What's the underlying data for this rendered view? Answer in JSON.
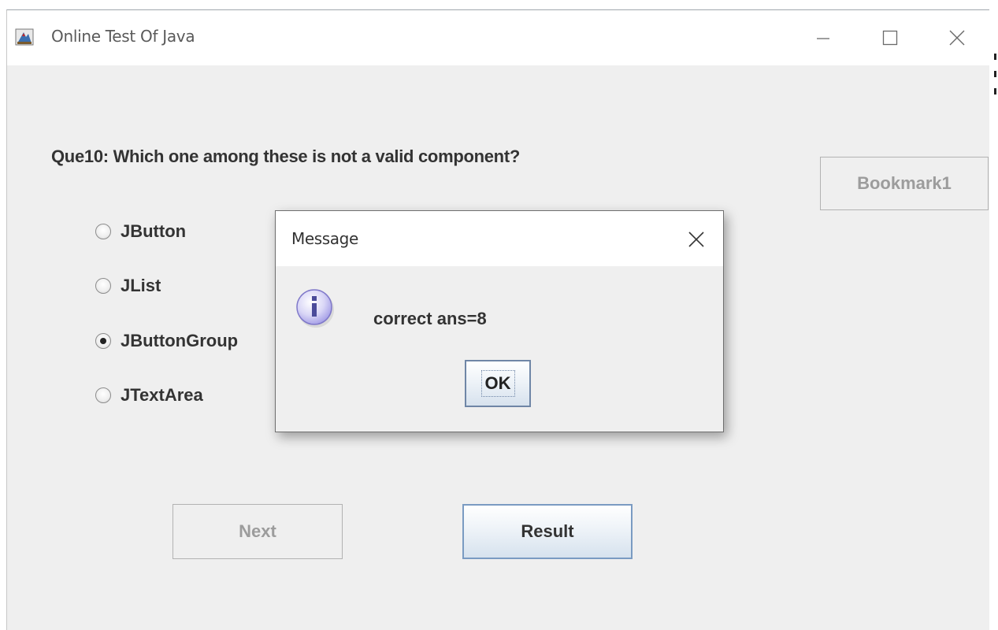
{
  "window": {
    "title": "Online Test Of Java",
    "icon": "java-app-icon",
    "controls": {
      "minimize": "—",
      "maximize": "☐",
      "close": "✕"
    }
  },
  "quiz": {
    "question": "Que10: Which one among these is not a valid component?",
    "options": [
      {
        "label": "JButton",
        "selected": false
      },
      {
        "label": "JList",
        "selected": false
      },
      {
        "label": "JButtonGroup",
        "selected": true
      },
      {
        "label": "JTextArea",
        "selected": false
      }
    ],
    "bookmark_label": "Bookmark1",
    "next_label": "Next",
    "result_label": "Result"
  },
  "dialog": {
    "title": "Message",
    "close": "✕",
    "icon": "info-icon",
    "message": "correct ans=8",
    "ok_label": "OK"
  },
  "colors": {
    "window_bg": "#efefef",
    "titlebar_bg": "#ffffff",
    "text": "#333333",
    "disabled_text": "#9c9c9c",
    "focus_border": "#7a9bc2",
    "info_icon": "#8f86d9"
  }
}
